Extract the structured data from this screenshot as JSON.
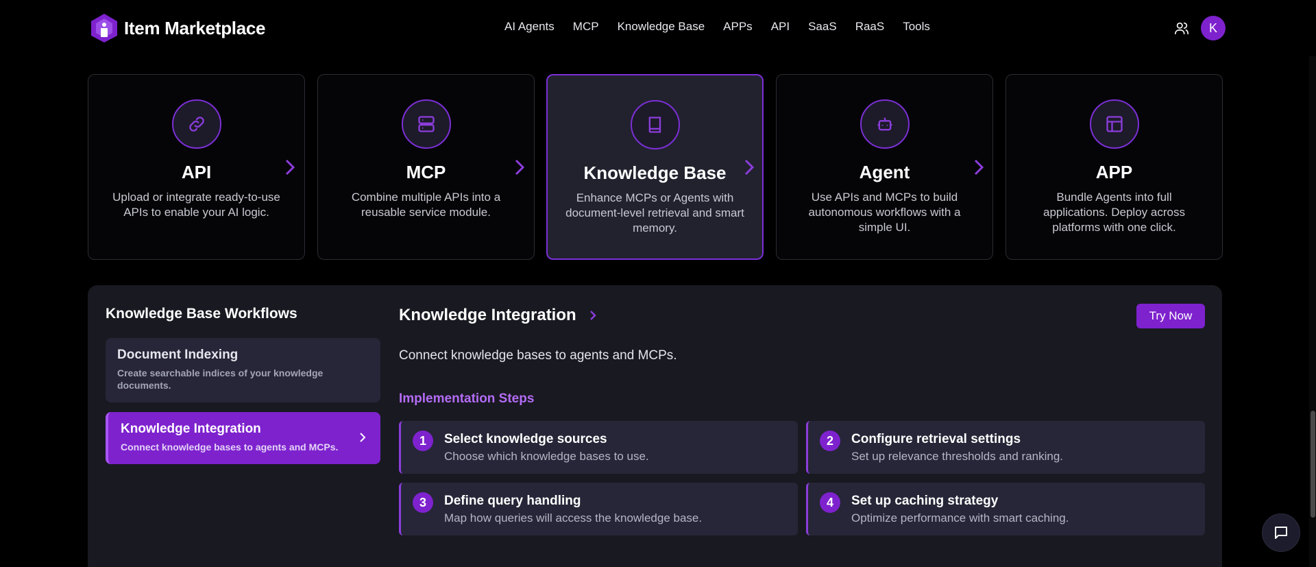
{
  "header": {
    "brand_name": "Item Marketplace",
    "nav": [
      "AI Agents",
      "MCP",
      "Knowledge Base",
      "APPs",
      "API",
      "SaaS",
      "RaaS",
      "Tools"
    ],
    "avatar_initial": "K"
  },
  "categories": [
    {
      "title": "API",
      "desc": "Upload or integrate ready-to-use APIs to enable your AI logic.",
      "icon": "link-icon",
      "active": false
    },
    {
      "title": "MCP",
      "desc": "Combine multiple APIs into a reusable service module.",
      "icon": "server-icon",
      "active": false
    },
    {
      "title": "Knowledge Base",
      "desc": "Enhance MCPs or Agents with document-level retrieval and smart memory.",
      "icon": "book-icon",
      "active": true
    },
    {
      "title": "Agent",
      "desc": "Use APIs and MCPs to build autonomous workflows with a simple UI.",
      "icon": "robot-icon",
      "active": false
    },
    {
      "title": "APP",
      "desc": "Bundle Agents into full applications. Deploy across platforms with one click.",
      "icon": "layout-icon",
      "active": false
    }
  ],
  "workflows": {
    "title": "Knowledge Base Workflows",
    "items": [
      {
        "title": "Document Indexing",
        "desc": "Create searchable indices of your knowledge documents."
      },
      {
        "title": "Knowledge Integration",
        "desc": "Connect knowledge bases to agents and MCPs."
      }
    ]
  },
  "detail": {
    "title": "Knowledge Integration",
    "try_label": "Try Now",
    "desc": "Connect knowledge bases to agents and MCPs.",
    "steps_heading": "Implementation Steps",
    "steps": [
      {
        "num": "1",
        "title": "Select knowledge sources",
        "desc": "Choose which knowledge bases to use."
      },
      {
        "num": "2",
        "title": "Configure retrieval settings",
        "desc": "Set up relevance thresholds and ranking."
      },
      {
        "num": "3",
        "title": "Define query handling",
        "desc": "Map how queries will access the knowledge base."
      },
      {
        "num": "4",
        "title": "Set up caching strategy",
        "desc": "Optimize performance with smart caching."
      }
    ]
  },
  "colors": {
    "accent": "#7e22ce",
    "accent_light": "#b46cf6",
    "panel": "#191921"
  }
}
